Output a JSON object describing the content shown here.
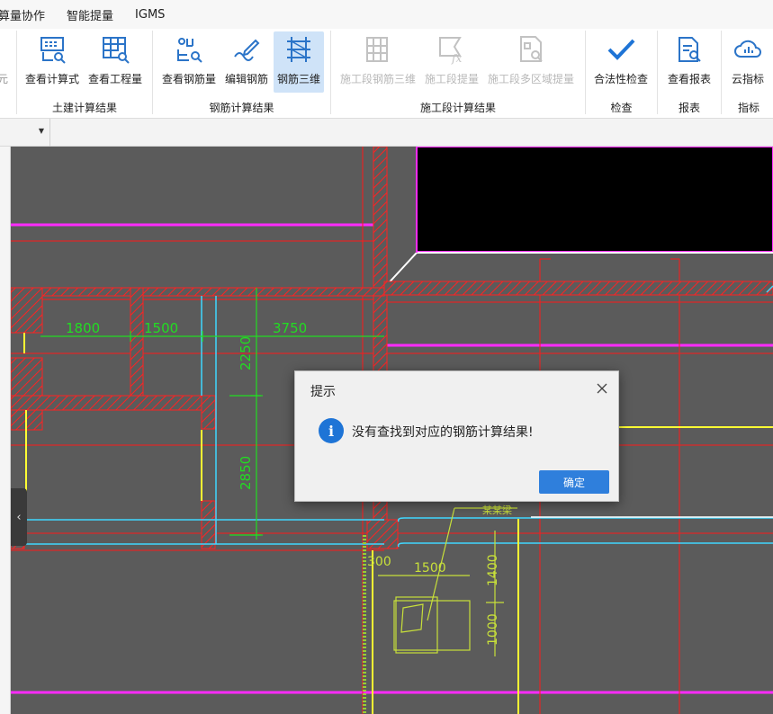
{
  "menu": [
    "算量协作",
    "智能提量",
    "IGMS"
  ],
  "ribbon": {
    "partial_left_label": "元",
    "buttons": [
      {
        "label": "查看计算式",
        "icon": "formula-search-icon"
      },
      {
        "label": "查看工程量",
        "icon": "quantity-table-icon"
      },
      {
        "label": "查看钢筋量",
        "icon": "rebar-quantity-icon"
      },
      {
        "label": "编辑钢筋",
        "icon": "edit-rebar-icon"
      },
      {
        "label": "钢筋三维",
        "icon": "rebar-3d-icon"
      },
      {
        "label": "施工段钢筋三维",
        "icon": "segment-rebar-3d-icon"
      },
      {
        "label": "施工段提量",
        "icon": "segment-fx-icon"
      },
      {
        "label": "施工段多区域提量",
        "icon": "multi-region-icon"
      },
      {
        "label": "合法性检查",
        "icon": "checkmark-icon"
      },
      {
        "label": "查看报表",
        "icon": "report-icon"
      },
      {
        "label": "云指标",
        "icon": "cloud-index-icon"
      }
    ],
    "groups": [
      "土建计算结果",
      "钢筋计算结果",
      "施工段计算结果",
      "检查",
      "报表",
      "指标"
    ]
  },
  "drawing": {
    "dims": [
      "1800",
      "1500",
      "3750",
      "2250",
      "2850",
      "300",
      "1500",
      "1400",
      "1000"
    ],
    "tag": "某某梁"
  },
  "dialog": {
    "title": "提示",
    "message": "没有查找到对应的钢筋计算结果!",
    "ok": "确定"
  },
  "colors": {
    "accent": "#2f7fdc",
    "info": "#1e74d6",
    "canvas": "#5b5b5b",
    "magenta": "#ff2bff",
    "red": "#ff1a1a",
    "green": "#22dd22",
    "cyan": "#40d8ff",
    "yellow": "#ffff33"
  }
}
